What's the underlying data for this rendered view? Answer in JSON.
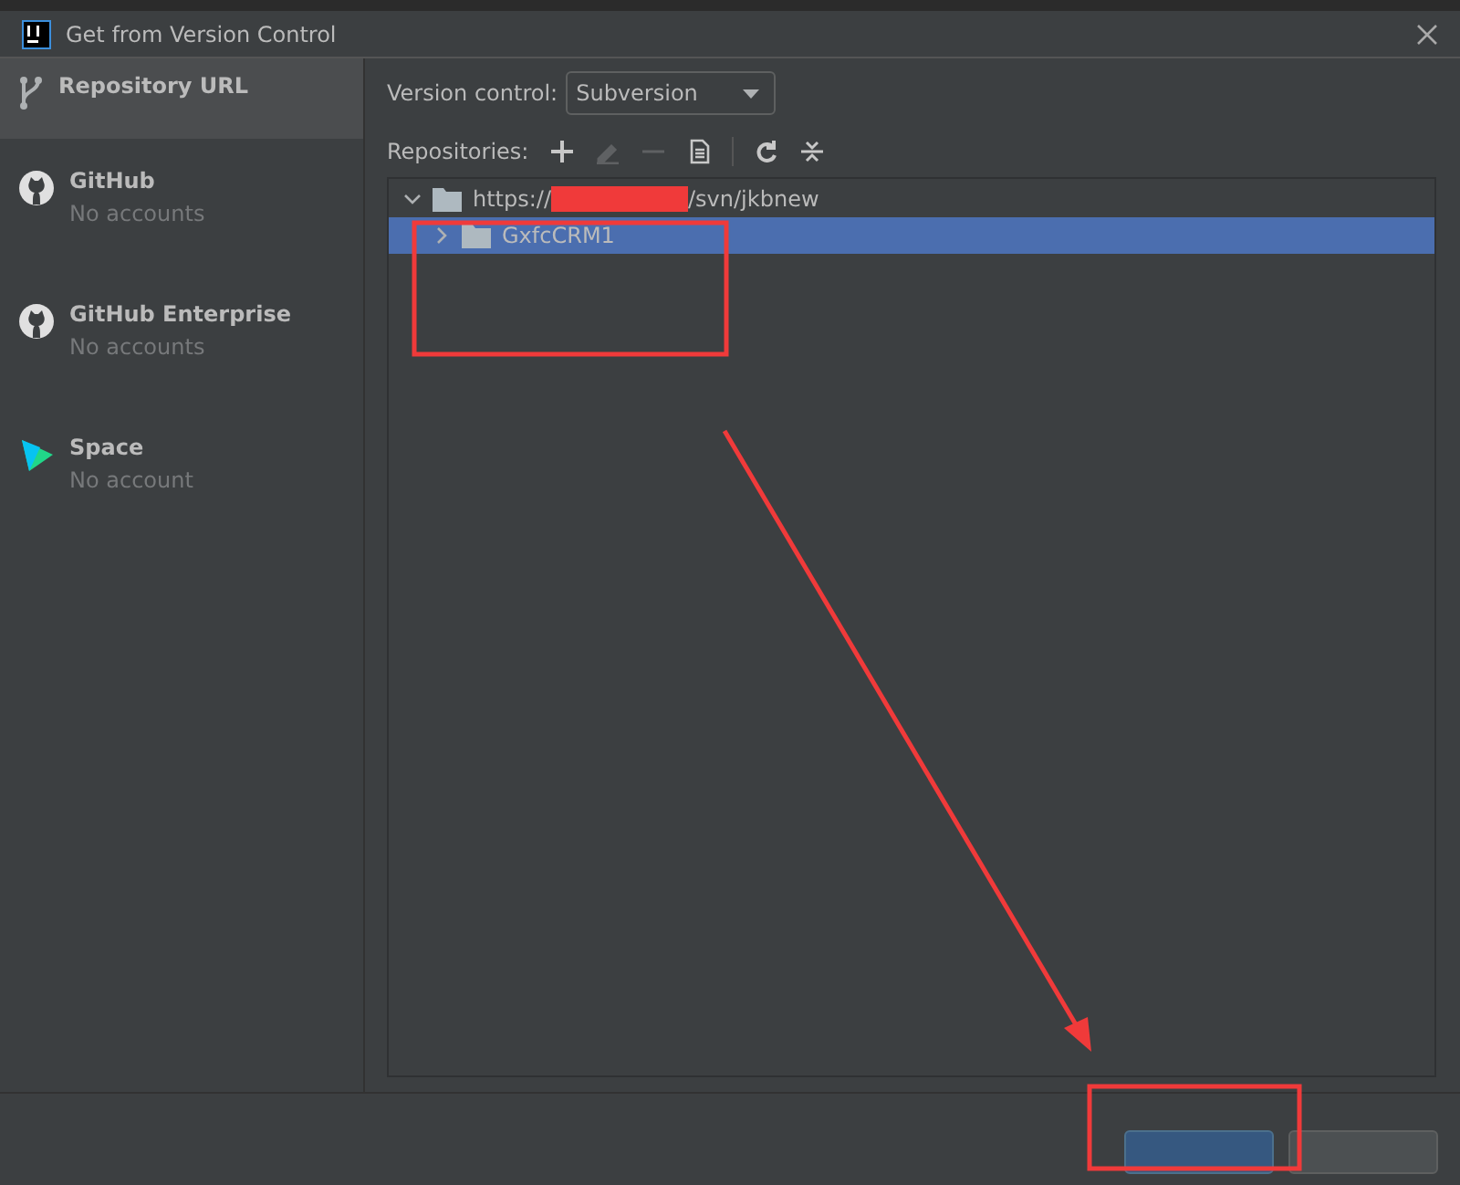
{
  "window": {
    "title": "Get from Version Control"
  },
  "sidebar": {
    "items": [
      {
        "kind": "url",
        "label": "Repository URL",
        "selected": true
      },
      {
        "kind": "github",
        "label": "GitHub",
        "sublabel": "No accounts",
        "selected": false
      },
      {
        "kind": "github",
        "label": "GitHub Enterprise",
        "sublabel": "No accounts",
        "selected": false
      },
      {
        "kind": "space",
        "label": "Space",
        "sublabel": "No account",
        "selected": false
      }
    ]
  },
  "version_control": {
    "label": "Version control:",
    "value": "Subversion"
  },
  "repositories": {
    "label": "Repositories:",
    "toolbar": [
      {
        "kind": "add",
        "disabled": false
      },
      {
        "kind": "edit",
        "disabled": true
      },
      {
        "kind": "remove",
        "disabled": true
      },
      {
        "kind": "browse",
        "disabled": false
      },
      {
        "kind": "refresh",
        "disabled": false
      },
      {
        "kind": "collapse",
        "disabled": false
      }
    ],
    "tree": [
      {
        "label_start": "https://",
        "label_end": "/svn/jkbnew",
        "redacted": true,
        "expanded": true,
        "selected": false,
        "children": [
          {
            "label": "GxfcCRM1",
            "expanded": false,
            "selected": true
          }
        ]
      }
    ]
  },
  "footer": {
    "buttons": [
      {
        "kind": "primary"
      },
      {
        "kind": "secondary"
      }
    ]
  }
}
